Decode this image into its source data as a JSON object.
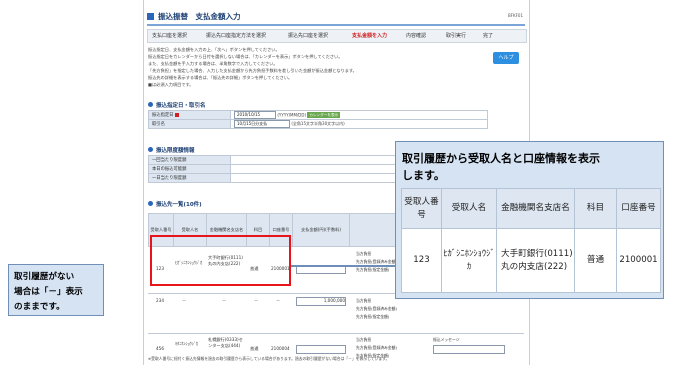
{
  "screen": {
    "title": "振込振替　支払金額入力",
    "screen_id": "BFKF01",
    "steps": [
      "支払口座を選択",
      "振込先口座指定方法を選択",
      "振込先口座を選択",
      "支払金額を入力",
      "内容確認",
      "取引実行",
      "完了"
    ],
    "current_step": "支払金額を入力",
    "instructions": [
      "振込指定日、支払金額を入力の上、「次へ」ボタンを押してください。",
      "振込指定日をカレンダーから日付を選択しない場合は、「カレンダーを表示」ボタンを押してください。",
      "また、支払金額を手入力する場合は、半角数字で入力してください。",
      "「先方負担」を指定した場合、入力した支払金額から先方負担手数料を差し引いた金額が振込金額となります。",
      "振込先の詳細を表示する場合は、「振込先の詳細」ボタンを押してください。",
      "■は必須入力項目です。"
    ],
    "help_label": "ヘルプ",
    "sec1_title": "振込指定日・取引名",
    "date_label": "振込指定日",
    "date_value": "2010/10/15",
    "date_format": "(YYYY/MM/DD)",
    "calendar_button": "カレンダーを表示",
    "txn_label": "取引名",
    "txn_value": "10月15日分支払",
    "txn_hint": "(全角15文字半角30文字以内)",
    "sec2_title": "振込限度額情報",
    "limits": [
      "一回当たり限度額",
      "本日の振込可能額",
      "一日当たり限度額"
    ],
    "sec3_title": "振込先一覧(10件)",
    "sort_label": "並び順：",
    "sort_value": "受取人番号",
    "headers": [
      "受取人番号",
      "受取人名",
      "金融機関名支店名",
      "科目",
      "口座番号",
      "支払金額(円)(手数料)",
      "手数料負担先(手数料等)"
    ],
    "rows": [
      {
        "no": "123",
        "name": "ﾋｶﾞｼﾆﾎﾝｼｮｳｼﾞｶ",
        "bank": "大手町銀行(0111)丸の内支店(222)",
        "type": "普通",
        "acct": "2100001",
        "amount": "",
        "opt1": "当方負担",
        "opt2": "先方負担(登録済み金額)",
        "opt3": "先方負担(指定金額)"
      },
      {
        "no": "234",
        "name": "－",
        "bank": "－",
        "type": "－",
        "acct": "－",
        "amount": "1,000,000",
        "opt1": "当方負担",
        "opt2": "先方負担(登録済み金額)",
        "opt3": "先方負担(指定金額)"
      },
      {
        "no": "456",
        "name": "ｷﾀﾆﾎﾝｼｮｳｼﾞｶ",
        "bank": "札幌銀行(0333)センター支店(444)",
        "type": "普通",
        "acct": "2100004",
        "amount": "",
        "opt1": "当方負担",
        "opt2": "先方負担(登録済み金額)",
        "opt3": "先方負担(指定金額)",
        "memo": "振込メッセージ"
      }
    ],
    "footnote": "※受取人番号に紐付く振込先情報を過去の取引履歴から表示している場合があります。過去の取引履歴がない場合は「－」を表示しています。"
  },
  "callout_left": {
    "line1": "取引履歴がない",
    "line2": "場合は「－」表示",
    "line3": "のままです。"
  },
  "popup": {
    "line1": "取引履歴から受取人名と口座情報を表示",
    "line2": "します。",
    "headers": {
      "no": "受取人番号",
      "name": "受取人名",
      "bank": "金融機関名支店名",
      "type": "科目",
      "acct": "口座番号"
    },
    "row": {
      "no": "123",
      "name": "ﾋｶﾞｼﾆﾎﾝｼｮｳｼﾞｶ",
      "bank": "大手町銀行(0111)丸の内支店(222)",
      "type": "普通",
      "acct": "2100001"
    }
  },
  "colors": {
    "highlight": "#e8141b",
    "callout_bg": "#d6e3f3",
    "accent": "#2c66b8"
  }
}
